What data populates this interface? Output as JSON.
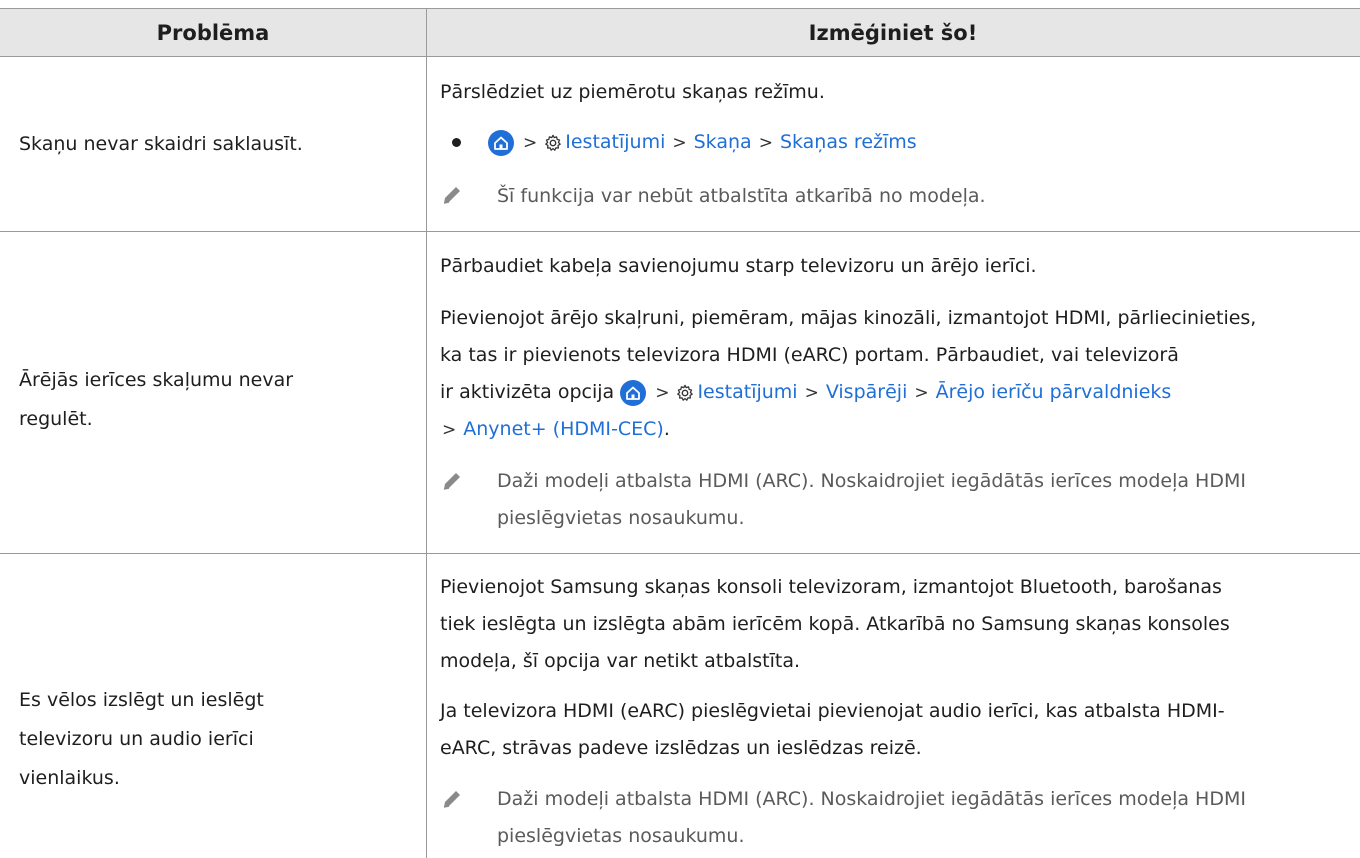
{
  "header": {
    "col1": "Problēma",
    "col2": "Izmēģiniet šo!"
  },
  "rows": [
    {
      "problem": "Skaņu nevar skaidri saklausīt.",
      "text1": "Pārslēdziet uz piemērotu skaņas režīmu.",
      "path": [
        "Iestatījumi",
        "Skaņa",
        "Skaņas režīms"
      ],
      "note": "Šī funkcija var nebūt atbalstīta atkarībā no modeļa."
    },
    {
      "problem_line1": "Ārējās ierīces skaļumu nevar",
      "problem_line2": "regulēt.",
      "text1": "Pārbaudiet kabeļa savienojumu starp televizoru un ārējo ierīci.",
      "text2_line1": "Pievienojot ārējo skaļruni, piemēram, mājas kinozāli, izmantojot HDMI, pārliecinieties,",
      "text2_line2": "ka tas ir pievienots televizora HDMI (eARC) portam. Pārbaudiet, vai televizorā",
      "text2_line3_prefix": "ir aktivizēta opcija",
      "path": [
        "Iestatījumi",
        "Vispārēji",
        "Ārējo ierīču pārvaldnieks",
        "Anynet+ (HDMI-CEC)"
      ],
      "note_line1": "Daži modeļi atbalsta HDMI (ARC). Noskaidrojiet iegādātās ierīces modeļa HDMI",
      "note_line2": "pieslēgvietas nosaukumu."
    },
    {
      "problem_line1": "Es vēlos izslēgt un ieslēgt",
      "problem_line2": "televizoru un audio ierīci",
      "problem_line3": "vienlaikus.",
      "text1_line1": "Pievienojot Samsung skaņas konsoli televizoram, izmantojot Bluetooth, barošanas",
      "text1_line2": "tiek ieslēgta un izslēgta abām ierīcēm kopā. Atkarībā no Samsung skaņas konsoles",
      "text1_line3": "modeļa, šī opcija var netikt atbalstīta.",
      "text2_line1": "Ja televizora HDMI (eARC) pieslēgvietai pievienojat audio ierīci, kas atbalsta HDMI-",
      "text2_line2": "eARC, strāvas padeve izslēdzas un ieslēdzas reizē.",
      "note_line1": "Daži modeļi atbalsta HDMI (ARC). Noskaidrojiet iegādātās ierīces modeļa HDMI",
      "note_line2": "pieslēgvietas nosaukumu."
    }
  ],
  "colors": {
    "link": "#1f6fd6",
    "header_bg": "#e6e6e6",
    "note_text": "#5a5a5a"
  },
  "icons": [
    "home-icon",
    "settings-gear-icon",
    "chevron-right-icon",
    "pencil-note-icon",
    "bullet-dot"
  ]
}
